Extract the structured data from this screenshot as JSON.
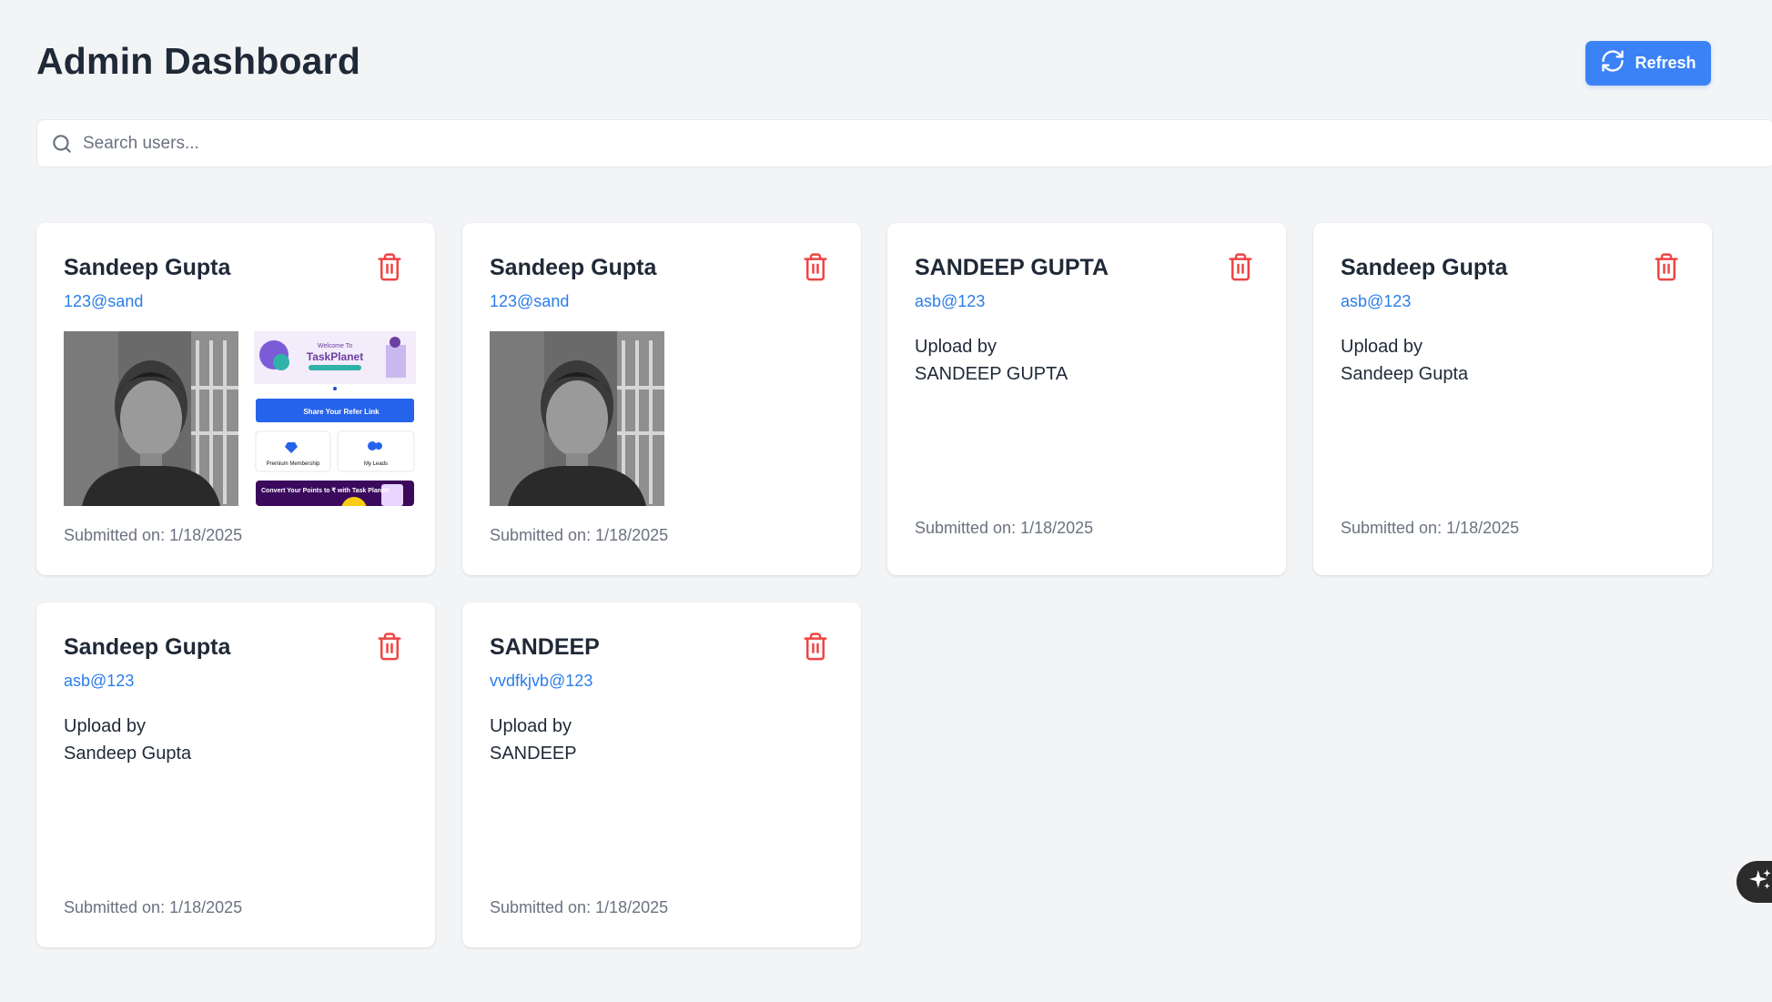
{
  "header": {
    "title": "Admin Dashboard",
    "refresh_label": "Refresh"
  },
  "search": {
    "placeholder": "Search users...",
    "value": ""
  },
  "colors": {
    "accent": "#3b82f6",
    "email_link": "#2b7de9",
    "delete": "#ef4444",
    "background": "#f3f4f6"
  },
  "screenshot_labels": {
    "welcome": "Welcome To",
    "brand": "TaskPlanet",
    "share": "Share Your Refer Link",
    "membership": "Premium Membership",
    "leads": "My Leads",
    "convert": "Convert Your Points to ₹ with Task Planet!"
  },
  "cards": [
    {
      "name": "Sandeep Gupta",
      "email": "123@sand",
      "submitted": "Submitted on: 1/18/2025",
      "images": [
        "photo",
        "taskplanet-screenshot"
      ]
    },
    {
      "name": "Sandeep Gupta",
      "email": "123@sand",
      "submitted": "Submitted on: 1/18/2025",
      "images": [
        "photo"
      ]
    },
    {
      "name": "SANDEEP GUPTA",
      "email": "asb@123",
      "submitted": "Submitted on: 1/18/2025",
      "alt_line1": "Upload by",
      "alt_line2": "SANDEEP GUPTA"
    },
    {
      "name": "Sandeep Gupta",
      "email": "asb@123",
      "submitted": "Submitted on: 1/18/2025",
      "alt_line1": "Upload by",
      "alt_line2": "Sandeep Gupta"
    },
    {
      "name": "Sandeep Gupta",
      "email": "asb@123",
      "submitted": "Submitted on: 1/18/2025",
      "alt_line1": "Upload by",
      "alt_line2": "Sandeep Gupta"
    },
    {
      "name": "SANDEEP",
      "email": "vvdfkjvb@123",
      "submitted": "Submitted on: 1/18/2025",
      "alt_line1": "Upload by",
      "alt_line2": "SANDEEP"
    }
  ],
  "icons": {
    "refresh": "refresh-icon",
    "search": "search-icon",
    "delete": "trash-icon",
    "assistant": "sparkle-icon"
  }
}
